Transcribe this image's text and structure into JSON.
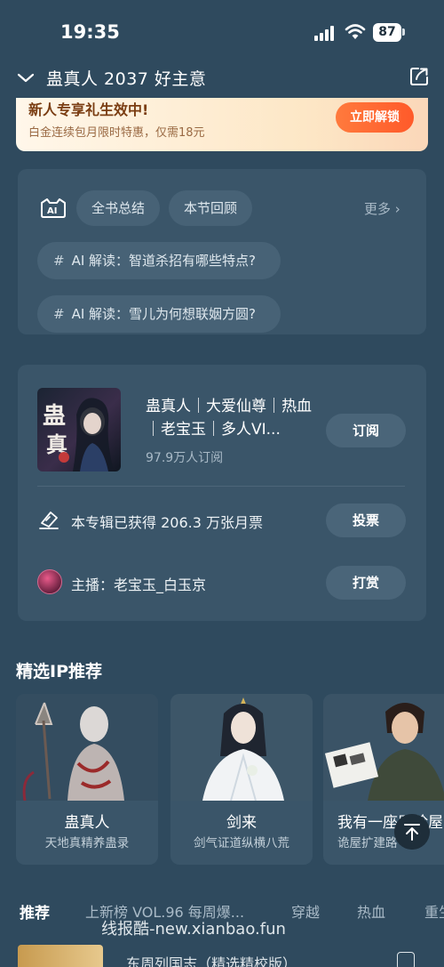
{
  "status_bar": {
    "time": "19:35",
    "battery": "87"
  },
  "header": {
    "title": "蛊真人 2037 好主意"
  },
  "banner": {
    "title": "新人专享礼生效中!",
    "subtitle": "白金连续包月限时特惠，仅需18元",
    "button": "立即解锁"
  },
  "ai_panel": {
    "chips": [
      "全书总结",
      "本节回顾"
    ],
    "more": "更多 ›",
    "questions": [
      "AI 解读：智道杀招有哪些特点?",
      "AI 解读：雪儿为何想联姻方圆?"
    ],
    "hash": "#"
  },
  "album": {
    "name": "蛊真人｜大爱仙尊｜热血｜老宝玉｜多人VI...",
    "subscribers": "97.9万人订阅",
    "subscribe_button": "订阅",
    "ticket_text": "本专辑已获得 206.3 万张月票",
    "vote_button": "投票",
    "anchor_text": "主播：老宝玉_白玉京",
    "tip_button": "打赏"
  },
  "ip_section": {
    "heading": "精选IP推荐",
    "items": [
      {
        "name": "蛊真人",
        "desc": "天地真精养蛊录"
      },
      {
        "name": "剑来",
        "desc": "剑气证道纵横八荒"
      },
      {
        "name": "我有一座冒险屋",
        "desc": "诡屋扩建路"
      }
    ]
  },
  "tabs": [
    "推荐",
    "上新榜 VOL.96 每周爆...",
    "穿越",
    "热血",
    "重生"
  ],
  "watermark": "线报酷-new.xianbao.fun",
  "bottom_item": {
    "title": "东周列国志（精选精校版）"
  },
  "colors": {
    "background": "#2f4a5e",
    "card": "#3a5569",
    "accent": "#ff5a2a"
  }
}
